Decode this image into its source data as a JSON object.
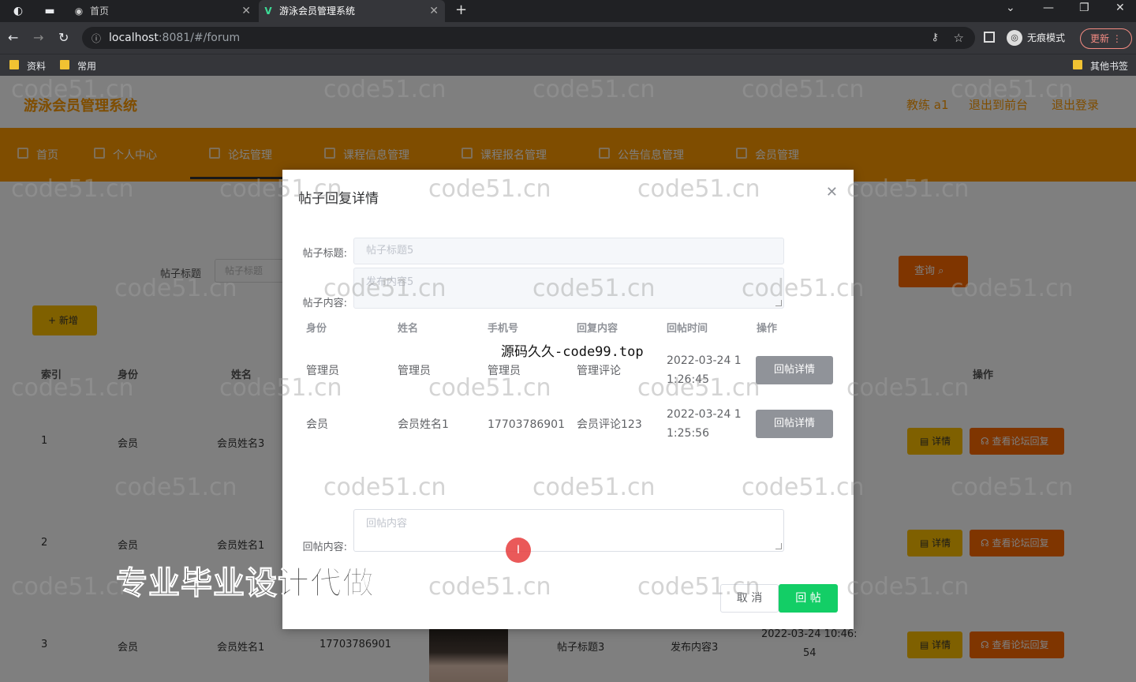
{
  "browser": {
    "tabs": [
      {
        "label": "首页",
        "icon": "globe-icon"
      },
      {
        "label": "游泳会员管理系统",
        "icon": "vue-logo-icon"
      }
    ],
    "url_host": "localhost",
    "url_rest": ":8081/#/forum",
    "incognito_label": "无痕模式",
    "update_label": "更新",
    "bookmarks": [
      "资料",
      "常用"
    ],
    "other_bookmarks": "其他书签"
  },
  "app": {
    "title": "游泳会员管理系统",
    "header_links": [
      "教练 a1",
      "退出到前台",
      "退出登录"
    ],
    "nav": [
      "首页",
      "个人中心",
      "论坛管理",
      "课程信息管理",
      "课程报名管理",
      "公告信息管理",
      "会员管理"
    ],
    "search": {
      "label": "帖子标题",
      "placeholder": "帖子标题",
      "button": "查询"
    },
    "add_button": "+ 新增",
    "table": {
      "headers": [
        "索引",
        "身份",
        "姓名",
        "操作"
      ],
      "rows": [
        {
          "index": "1",
          "role": "会员",
          "name": "会员姓名3"
        },
        {
          "index": "2",
          "role": "会员",
          "name": "会员姓名1"
        },
        {
          "index": "3",
          "role": "会员",
          "name": "会员姓名1",
          "phone": "17703786901",
          "title": "帖子标题3",
          "content": "发布内容3",
          "time_line1": "2022-03-24 10:46:",
          "time_line2": "54"
        }
      ],
      "detail_button": "详情",
      "view_reply_button": "查看论坛回复"
    }
  },
  "modal": {
    "title": "帖子回复详情",
    "post_title_label": "帖子标题:",
    "post_title_value": "帖子标题5",
    "post_content_label": "帖子内容:",
    "post_content_value": "发布内容5",
    "reply_table": {
      "headers": [
        "身份",
        "姓名",
        "手机号",
        "回复内容",
        "回帖时间",
        "操作"
      ],
      "rows": [
        {
          "role": "管理员",
          "name": "管理员",
          "phone": "管理员",
          "content": "管理评论",
          "time_line1": "2022-03-24 1",
          "time_line2": "1:26:45"
        },
        {
          "role": "会员",
          "name": "会员姓名1",
          "phone": "17703786901",
          "content": "会员评论123",
          "time_line1": "2022-03-24 1",
          "time_line2": "1:25:56"
        }
      ],
      "detail_button": "回帖详情"
    },
    "reply_label": "回帖内容:",
    "reply_placeholder": "回帖内容",
    "cancel_button": "取 消",
    "submit_button": "回 帖"
  },
  "watermarks": {
    "site": "code51.cn",
    "code99": "源码久久-code99.top",
    "ad": "专业毕业设计代做"
  }
}
